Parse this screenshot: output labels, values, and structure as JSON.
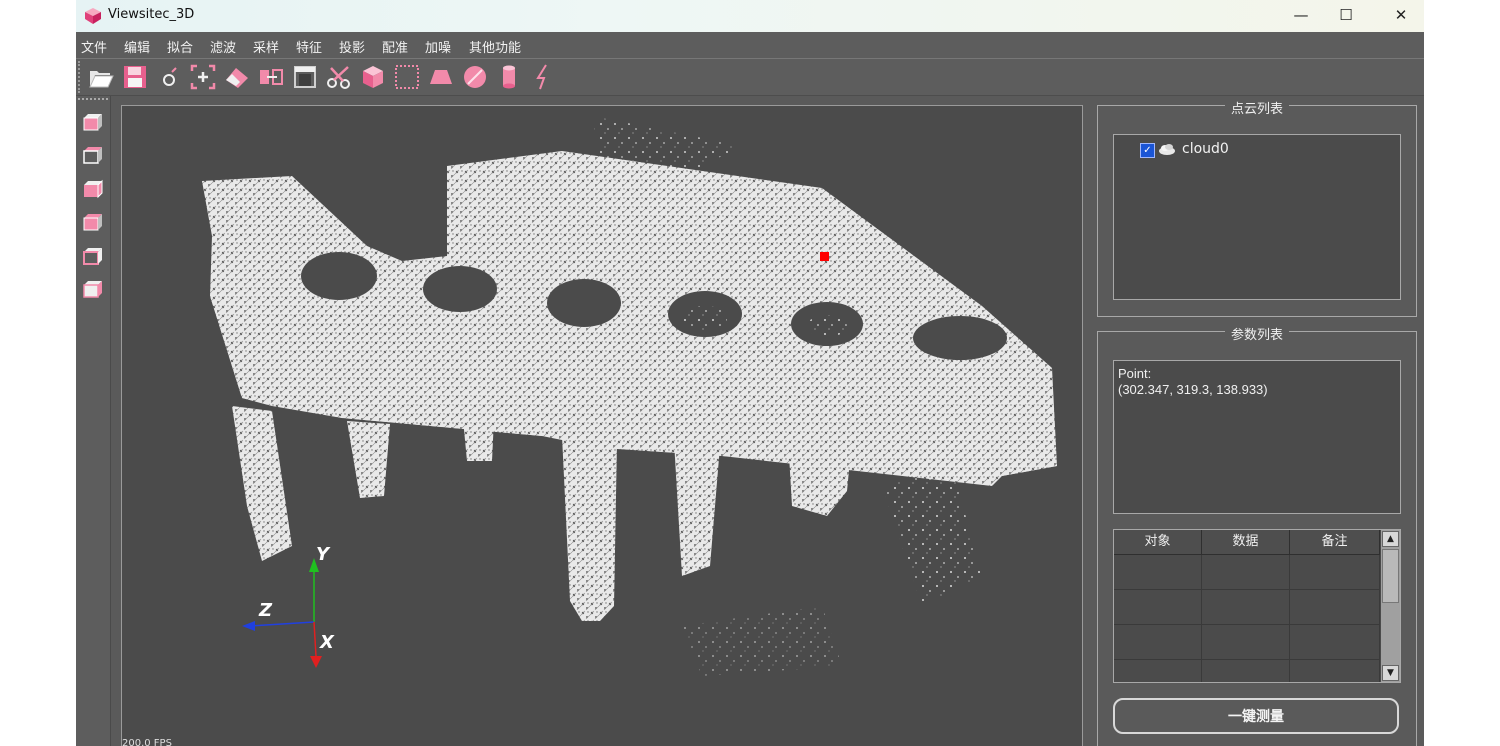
{
  "window": {
    "title": "Viewsitec_3D",
    "controls": {
      "minimize": "—",
      "maximize": "☐",
      "close": "✕"
    }
  },
  "menu": [
    "文件",
    "编辑",
    "拟合",
    "滤波",
    "采样",
    "特征",
    "投影",
    "配准",
    "加噪",
    "其他功能"
  ],
  "toolbar_icons": [
    "open-folder-icon",
    "save-icon",
    "point-icon",
    "add-point-icon",
    "eraser-icon",
    "boundary-icon",
    "frame-icon",
    "scissors-icon",
    "cube-icon",
    "selection-box-icon",
    "trapezoid-icon",
    "sphere-icon",
    "cylinder-icon",
    "lightning-icon"
  ],
  "view_icons": [
    "view-front-icon",
    "view-back-icon",
    "view-left-icon",
    "view-right-icon",
    "view-top-icon",
    "view-bottom-icon"
  ],
  "viewport": {
    "fps": "200.0 FPS",
    "axes": {
      "x": "X",
      "y": "Y",
      "z": "Z"
    },
    "colors": {
      "x_axis": "#e02020",
      "y_axis": "#20c020",
      "z_axis": "#2040e0",
      "picked_point": "#ff0000"
    }
  },
  "cloud_panel": {
    "title": "点云列表",
    "items": [
      {
        "name": "cloud0",
        "checked": true
      }
    ]
  },
  "param_panel": {
    "title": "参数列表",
    "point_label": "Point:",
    "point_value": "(302.347, 319.3, 138.933)"
  },
  "table": {
    "headers": [
      "对象",
      "数据",
      "备注"
    ],
    "rows": [
      [
        "",
        "",
        ""
      ],
      [
        "",
        "",
        ""
      ],
      [
        "",
        "",
        ""
      ],
      [
        "",
        "",
        ""
      ]
    ]
  },
  "measure_button": "一键测量"
}
